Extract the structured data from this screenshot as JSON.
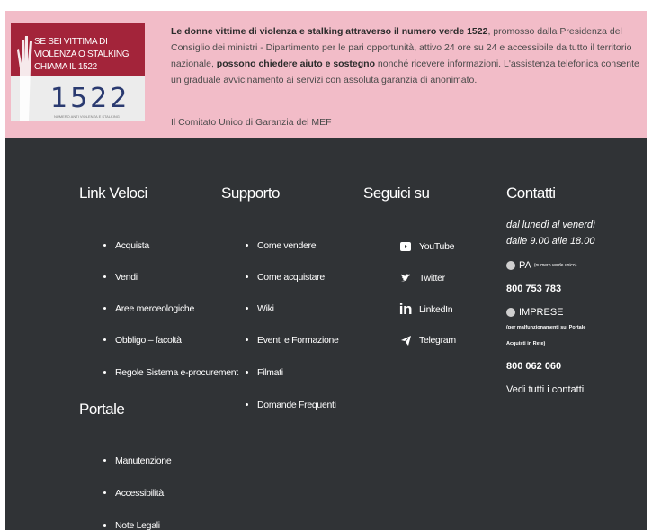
{
  "banner": {
    "image_slogan": "SE SEI VITTIMA DI VIOLENZA O STALKING CHIAMA IL 1522",
    "image_number": "1522",
    "image_caption": "NUMERO ANTI VIOLENZA E STALKING",
    "text_bold_1": "Le donne vittime di violenza e stalking attraverso il numero verde 1522",
    "text_1": ", promosso dalla Presidenza del Consiglio dei ministri - Dipartimento per le pari opportunità, attivo 24 ore su 24 e accessibile da tutto il territorio nazionale, ",
    "text_bold_2": "possono chiedere aiuto e sostegno",
    "text_2": " nonché ricevere informazioni. L'assistenza telefonica consente un graduale avvicinamento ai servizi con assoluta garanzia di anonimato.",
    "signature": "Il Comitato Unico di Garanzia del MEF"
  },
  "footer": {
    "link_veloci": {
      "title": "Link Veloci",
      "items": [
        "Acquista",
        "Vendi",
        "Aree merceologiche",
        "Obbligo – facoltà",
        "Regole Sistema e-procurement"
      ]
    },
    "portale": {
      "title": "Portale",
      "items": [
        "Manutenzione",
        "Accessibilità",
        "Note Legali"
      ]
    },
    "supporto": {
      "title": "Supporto",
      "items": [
        "Come vendere",
        "Come acquistare",
        "Wiki",
        "Eventi e Formazione",
        "Filmati",
        "Domande Frequenti"
      ]
    },
    "seguici": {
      "title": "Seguici su",
      "items": [
        {
          "label": "YouTube",
          "icon": "youtube-icon"
        },
        {
          "label": "Twitter",
          "icon": "twitter-icon"
        },
        {
          "label": "LinkedIn",
          "icon": "linkedin-icon"
        },
        {
          "label": "Telegram",
          "icon": "telegram-icon"
        }
      ]
    },
    "contatti": {
      "title": "Contatti",
      "hours_1": "dal lunedì al venerdì",
      "hours_2": "dalle 9.00 alle 18.00",
      "pa_label": "PA",
      "pa_note": "(numero verde unico)",
      "pa_phone": "800 753 783",
      "imprese_label": "IMPRESE",
      "imprese_note_1": "(per malfunzionamenti sul Portale",
      "imprese_note_2": "Acquisti in Rete)",
      "imprese_phone": "800 062 060",
      "all_contacts": "Vedi tutti i contatti"
    }
  }
}
